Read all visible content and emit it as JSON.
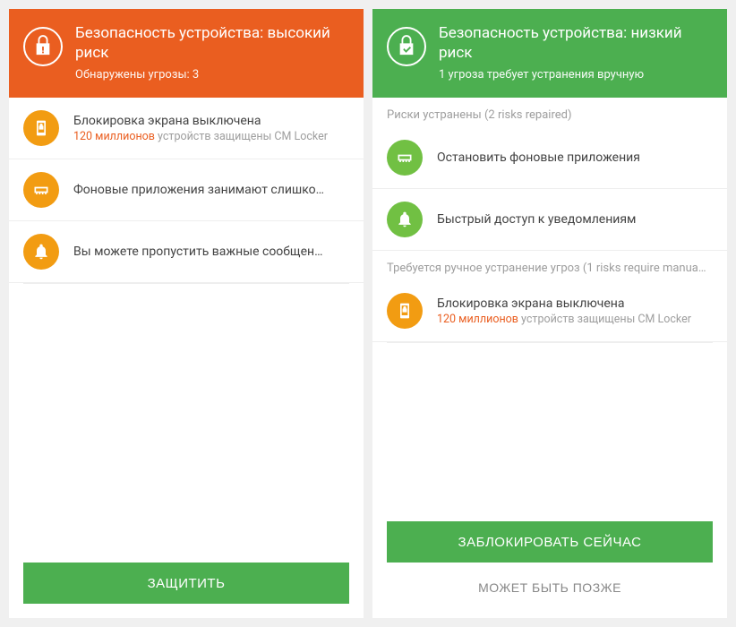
{
  "left": {
    "header": {
      "title": "Безопасность устройства: высокий риск",
      "subtitle": "Обнаружены угрозы: 3"
    },
    "items": [
      {
        "title": "Блокировка экрана выключена",
        "sub_highlight": "120 миллионов",
        "sub_rest": " устройств защищены CM Locker"
      },
      {
        "title": "Фоновые приложения занимают слишко…"
      },
      {
        "title": "Вы можете пропустить важные сообщен…"
      }
    ],
    "button_primary": "ЗАЩИТИТЬ"
  },
  "right": {
    "header": {
      "title": "Безопасность устройства: низкий риск",
      "subtitle": "1 угроза требует устранения вручную"
    },
    "section_repaired": "Риски устранены (2 risks repaired)",
    "repaired_items": [
      {
        "title": "Остановить фоновые приложения"
      },
      {
        "title": "Быстрый доступ к уведомлениям"
      }
    ],
    "section_manual": "Требуется ручное устранение угроз (1 risks require manua…",
    "manual_items": [
      {
        "title": "Блокировка экрана выключена",
        "sub_highlight": "120 миллионов",
        "sub_rest": " устройств защищены CM Locker"
      }
    ],
    "button_primary": "ЗАБЛОКИРОВАТЬ СЕЙЧАС",
    "button_secondary": "МОЖЕТ БЫТЬ ПОЗЖЕ"
  }
}
